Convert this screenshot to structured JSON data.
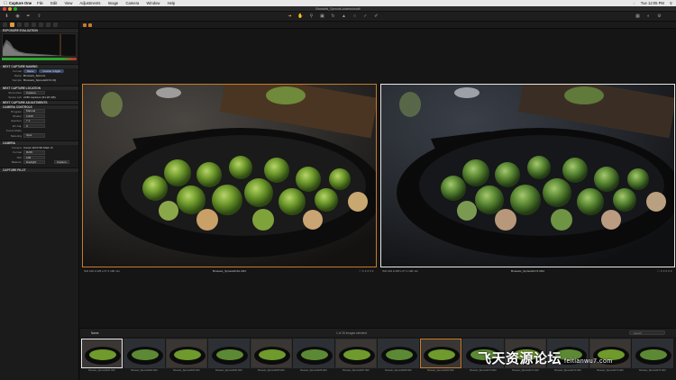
{
  "menubar": {
    "app": "Capture One",
    "menus": [
      "File",
      "Edit",
      "View",
      "Adjustments",
      "Image",
      "Camera",
      "Window",
      "Help"
    ],
    "time": "Tue 12:05 PM"
  },
  "window": {
    "title": "Brussels_Sprouts.cosessiondb"
  },
  "left_panel": {
    "sections": {
      "exposure_evaluation": "EXPOSURE EVALUATION",
      "next_capture_naming": "NEXT CAPTURE NAMING",
      "next_capture_location": "NEXT CAPTURE LOCATION",
      "next_capture_adjustments": "NEXT CAPTURE ADJUSTMENTS",
      "camera_controls": "CAMERA CONTROLS",
      "camera": "CAMERA",
      "capture_pilot": "CAPTURE PILOT"
    },
    "naming": {
      "format_label": "Format",
      "format_tags": [
        "Name",
        "Counter 4 digits"
      ],
      "name_label": "Name",
      "name_value": "Brussels_Sprouts",
      "sample_label": "Sample",
      "sample_value": "Brussels_Sprouts0174.IIQ"
    },
    "location": {
      "store_label": "Store Files",
      "store_value": "Capture",
      "space_label": "Space Left",
      "space_value": "2236 captures (61.20 GB)"
    },
    "controls": {
      "program_label": "Program",
      "program_value": "Manual",
      "shutter_label": "Shutter",
      "shutter_value": "1/125",
      "aperture_label": "Aperture",
      "aperture_value": "7.1",
      "ev_label": "EV Adj.",
      "ev_value": "0",
      "focus_label": "Focus Mode",
      "metering_label": "Metering",
      "metering_value": "Spot"
    },
    "camera": {
      "camera_label": "Camera",
      "camera_value": "Canon EOS 5D Mark III",
      "format_label": "Format",
      "format_value": "RAW",
      "iso_label": "ISO",
      "iso_value": "100",
      "balance_label": "Balance",
      "balance_value": "Daylight",
      "capture_button": "Capture"
    }
  },
  "viewer": {
    "left_caption": {
      "info": "ISO 100   1/125 s   f/7.1   100 mm",
      "name": "Brussels_Sprouts0161.CR2"
    },
    "right_caption": {
      "info": "ISO 100   1/125 s   f/7.1   100 mm",
      "name": "Brussels_Sprouts0174.CR2"
    }
  },
  "filmstrip": {
    "sort": "Name",
    "count": "1 of 26 Images selected",
    "search_placeholder": "Search",
    "thumbs": [
      {
        "name": "Brussels_Sprouts0161.CR2",
        "state": "sel"
      },
      {
        "name": "Brussels_Sprouts0162.CR2",
        "state": ""
      },
      {
        "name": "Brussels_Sprouts0163.CR2",
        "state": ""
      },
      {
        "name": "Brussels_Sprouts0164.CR2",
        "state": ""
      },
      {
        "name": "Brussels_Sprouts0165.CR2",
        "state": ""
      },
      {
        "name": "Brussels_Sprouts0166.CR2",
        "state": ""
      },
      {
        "name": "Brussels_Sprouts0167.CR2",
        "state": ""
      },
      {
        "name": "Brussels_Sprouts0168.CR2",
        "state": ""
      },
      {
        "name": "Brussels_Sprouts0169.CR2",
        "state": "cur"
      },
      {
        "name": "Brussels_Sprouts0170.CR2",
        "state": ""
      },
      {
        "name": "Brussels_Sprouts0171.CR2",
        "state": ""
      },
      {
        "name": "Brussels_Sprouts0172.CR2",
        "state": ""
      },
      {
        "name": "Brussels_Sprouts0173.CR2",
        "state": ""
      },
      {
        "name": "Brussels_Sprouts0174.CR2",
        "state": ""
      }
    ]
  },
  "watermark": {
    "text": "飞天资源论坛",
    "url": "feitianwu7.com"
  },
  "colors": {
    "accent": "#c57c2a",
    "selection": "#e8e8e8"
  }
}
